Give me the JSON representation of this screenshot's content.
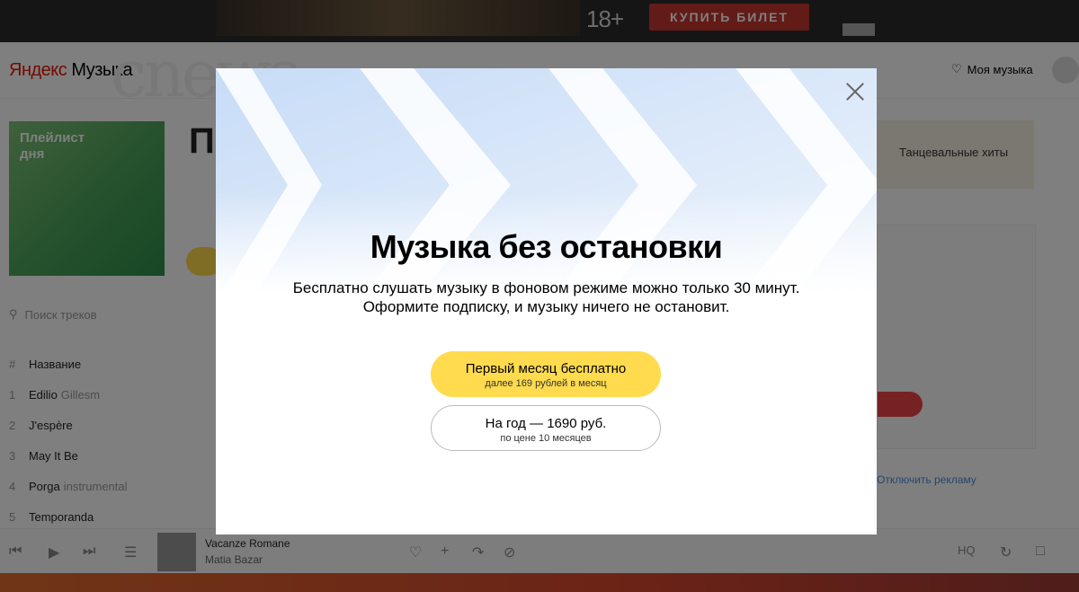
{
  "ad": {
    "age_rating": "18+",
    "buy_label": "КУПИТЬ БИЛЕТ"
  },
  "header": {
    "logo_accent": "Яндекс",
    "logo_rest": "Музыка",
    "my_music": "Моя музыка"
  },
  "watermark": "cnews",
  "background": {
    "playlist_cover_label": "Плейлист дня",
    "right_tile_label": "Танцевальные хиты",
    "right_link": "Отключить рекламу",
    "search_placeholder": "Поиск треков",
    "tracks_header": "Название",
    "tracks": [
      {
        "n": "1",
        "title": "Edilio",
        "extra": "Gillesm"
      },
      {
        "n": "2",
        "title": "J'espère",
        "extra": ""
      },
      {
        "n": "3",
        "title": "May It Be",
        "extra": ""
      },
      {
        "n": "4",
        "title": "Porga",
        "extra": "instrumental"
      },
      {
        "n": "5",
        "title": "Temporanda",
        "extra": ""
      }
    ]
  },
  "player": {
    "song": "Vacanze Romane",
    "artist": "Matia Bazar",
    "quality": "HQ"
  },
  "modal": {
    "title": "Музыка без остановки",
    "description_line1": "Бесплатно слушать музыку в фоновом режиме можно только 30 минут.",
    "description_line2": "Оформите подписку, и музыку ничего не остановит.",
    "primary_button": {
      "label": "Первый месяц бесплатно",
      "sublabel": "далее 169 рублей в месяц"
    },
    "secondary_button": {
      "label": "На год — 1690 руб.",
      "sublabel": "по цене 10 месяцев"
    }
  },
  "colors": {
    "accent_yellow": "#ffdb4d",
    "overlay": "rgba(0,0,0,0.5)",
    "brand_red": "#e61400"
  }
}
